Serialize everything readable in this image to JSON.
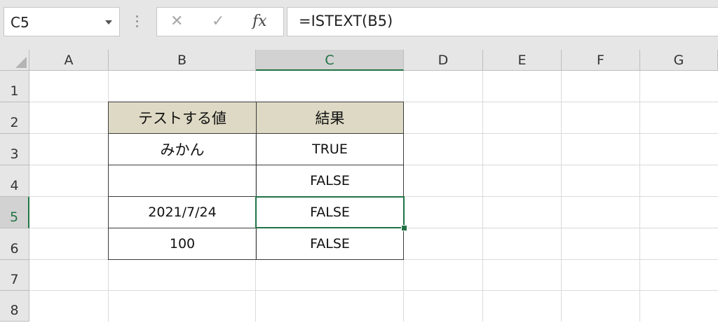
{
  "formula_bar": {
    "name_box": "C5",
    "cancel_icon": "✕",
    "enter_icon": "✓",
    "fx_label": "fx",
    "formula": "=ISTEXT(B5)"
  },
  "columns": [
    "A",
    "B",
    "C",
    "D",
    "E",
    "F",
    "G"
  ],
  "rows": [
    "1",
    "2",
    "3",
    "4",
    "5",
    "6",
    "7",
    "8"
  ],
  "selected": {
    "cell": "C5",
    "column": "C",
    "row": "5"
  },
  "table": {
    "headers": [
      "テストする値",
      "結果"
    ],
    "rows": [
      [
        "みかん",
        "TRUE"
      ],
      [
        "",
        "FALSE"
      ],
      [
        "2021/7/24",
        "FALSE"
      ],
      [
        "100",
        "FALSE"
      ]
    ]
  },
  "colors": {
    "accent": "#217346",
    "header_fill": "#ddd9c4"
  },
  "icons": [
    "cancel-icon",
    "enter-icon",
    "insert-function-icon",
    "dropdown-icon",
    "select-all-icon"
  ]
}
